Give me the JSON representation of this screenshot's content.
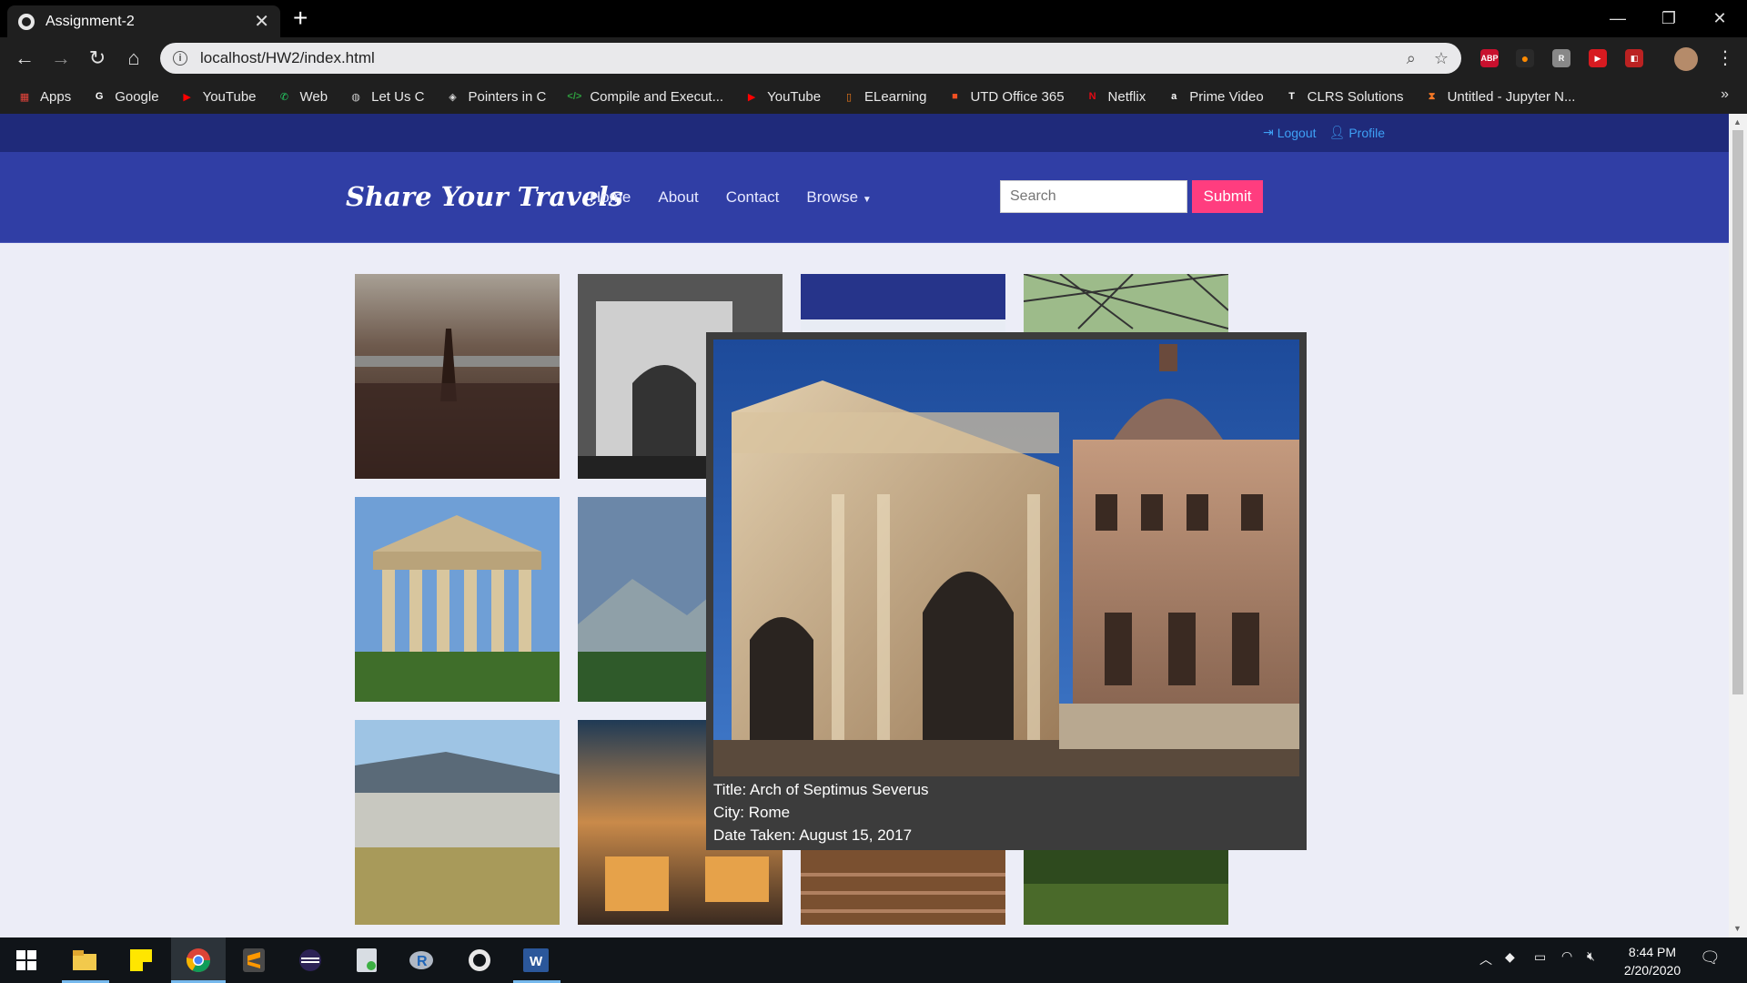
{
  "browser": {
    "tab_title": "Assignment-2",
    "url": "localhost/HW2/index.html",
    "bookmarks": [
      {
        "label": "Apps",
        "icon": "apps-grid-icon",
        "color": "#e8453c"
      },
      {
        "label": "Google",
        "icon": "google-icon",
        "color": "#ffffff"
      },
      {
        "label": "YouTube",
        "icon": "youtube-icon",
        "color": "#ff0000"
      },
      {
        "label": "Web",
        "icon": "whatsapp-icon",
        "color": "#25d366"
      },
      {
        "label": "Let Us C",
        "icon": "globe-icon",
        "color": "#cccccc"
      },
      {
        "label": "Pointers in C",
        "icon": "pointers-icon",
        "color": "#dddddd"
      },
      {
        "label": "Compile and Execut...",
        "icon": "code-icon",
        "color": "#2e9e3e"
      },
      {
        "label": "YouTube",
        "icon": "youtube-icon",
        "color": "#ff0000"
      },
      {
        "label": "ELearning",
        "icon": "elearning-icon",
        "color": "#f07a1a"
      },
      {
        "label": "UTD Office 365",
        "icon": "office365-icon",
        "color": "#f25022"
      },
      {
        "label": "Netflix",
        "icon": "netflix-icon",
        "color": "#e50914"
      },
      {
        "label": "Prime Video",
        "icon": "amazon-icon",
        "color": "#ffffff"
      },
      {
        "label": "CLRS Solutions",
        "icon": "clrs-icon",
        "color": "#ffffff"
      },
      {
        "label": "Untitled - Jupyter N...",
        "icon": "jupyter-icon",
        "color": "#f37726"
      }
    ]
  },
  "page": {
    "top_links": {
      "logout": "Logout",
      "profile": "Profile"
    },
    "brand": "Share Your Travels",
    "nav": [
      "Home",
      "About",
      "Contact",
      "Browse"
    ],
    "search_placeholder": "Search",
    "submit_label": "Submit",
    "popup": {
      "title_line": "Title: Arch of Septimus Severus",
      "city_line": "City: Rome",
      "date_line": "Date Taken: August 15, 2017"
    }
  },
  "taskbar": {
    "time": "8:44 PM",
    "date": "2/20/2020"
  }
}
